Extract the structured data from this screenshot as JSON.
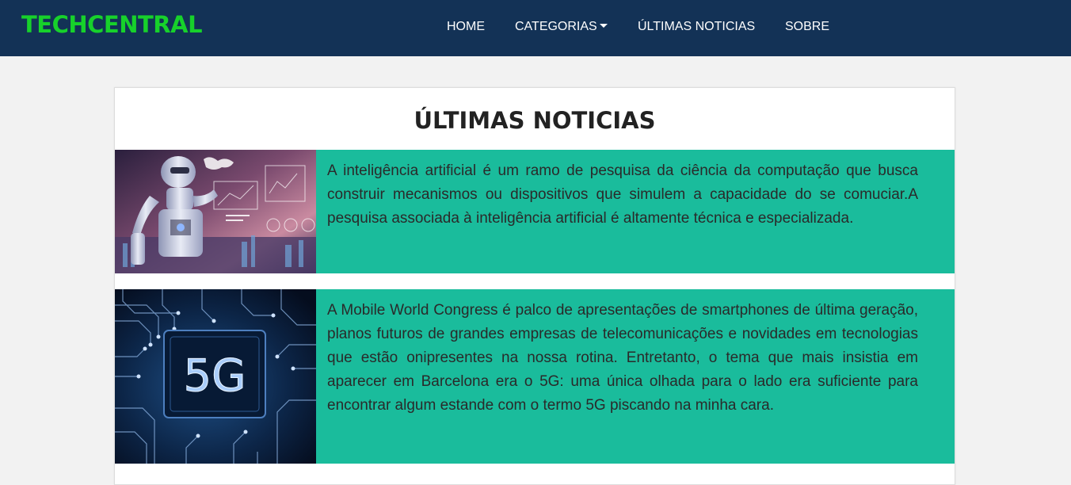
{
  "colors": {
    "navbar_bg": "#133256",
    "brand": "#17d12b",
    "news_bg": "#1abc9c",
    "page_bg": "#f2f2f2"
  },
  "navbar": {
    "brand": "TECHCENTRAL",
    "items": [
      {
        "label": "HOME"
      },
      {
        "label": "CATEGORIAS",
        "icon": "caret-down-icon"
      },
      {
        "label": "ÚLTIMAS NOTICIAS"
      },
      {
        "label": "SOBRE"
      }
    ]
  },
  "main": {
    "title": "ÚLTIMAS NOTICIAS",
    "news": [
      {
        "image": "robot-ai-image",
        "text": "A inteligência artificial é um ramo de pesquisa da ciência da computação que busca construir mecanismos ou dispositivos que simulem a capacidade do se comuciar.A pesquisa associada à inteligência artificial é altamente técnica e especializada."
      },
      {
        "image": "5g-chip-image",
        "image_label": "5G",
        "text": "A Mobile World Congress é palco de apresentações de smartphones de última geração, planos futuros de grandes empresas de telecomunicações e novidades em tecnologias que estão onipresentes na nossa rotina. Entretanto, o tema que mais insistia em aparecer em Barcelona era o 5G: uma única olhada para o lado era suficiente para encontrar algum estande com o termo 5G piscando na minha cara."
      }
    ]
  }
}
